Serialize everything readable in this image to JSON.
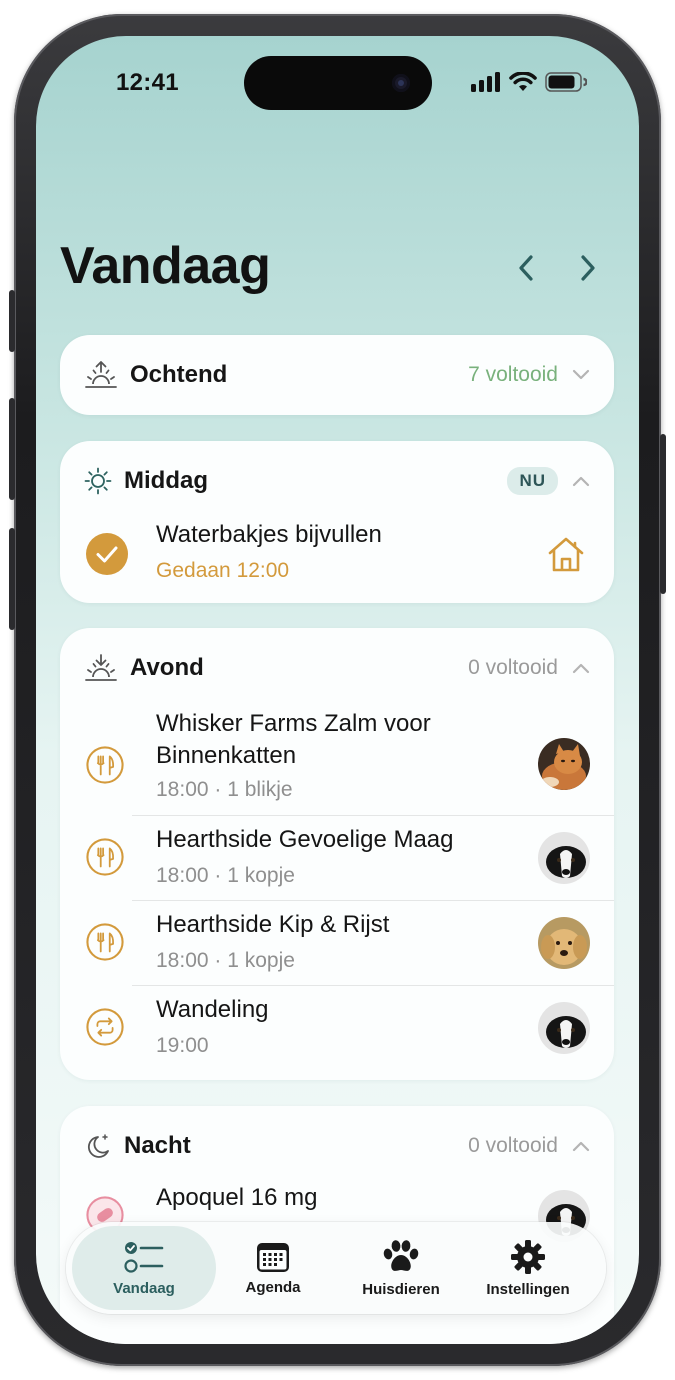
{
  "status_bar": {
    "time": "12:41"
  },
  "header": {
    "title": "Vandaag"
  },
  "sections": [
    {
      "title": "Ochtend",
      "summary": "7 voltooid",
      "icon": "sunrise-icon",
      "expanded": false
    },
    {
      "title": "Middag",
      "badge": "NU",
      "icon": "sun-icon",
      "expanded": true,
      "tasks": [
        {
          "title": "Waterbakjes bijvullen",
          "subtitle": "Gedaan 12:00",
          "status": "done",
          "trailing_icon": "house-icon"
        }
      ]
    },
    {
      "title": "Avond",
      "summary": "0 voltooid",
      "icon": "sunset-icon",
      "expanded": true,
      "tasks": [
        {
          "title": "Whisker Farms Zalm voor Binnenkatten",
          "subtitle": "18:00 · 1 blikje",
          "icon": "food-icon",
          "pet": "orange-cat"
        },
        {
          "title": "Hearthside Gevoelige Maag",
          "subtitle": "18:00 · 1 kopje",
          "icon": "food-icon",
          "pet": "border-collie"
        },
        {
          "title": "Hearthside Kip & Rijst",
          "subtitle": "18:00 · 1 kopje",
          "icon": "food-icon",
          "pet": "golden-retriever"
        },
        {
          "title": "Wandeling",
          "subtitle": "19:00",
          "icon": "walk-repeat-icon",
          "pet": "border-collie"
        }
      ]
    },
    {
      "title": "Nacht",
      "summary": "0 voltooid",
      "icon": "moon-icon",
      "expanded": true,
      "tasks": [
        {
          "title": "Apoquel 16 mg",
          "icon": "pill-icon",
          "pet": "border-collie"
        }
      ]
    }
  ],
  "tabbar": {
    "tabs": [
      {
        "label": "Vandaag",
        "icon": "checklist-icon",
        "active": true
      },
      {
        "label": "Agenda",
        "icon": "calendar-icon",
        "active": false
      },
      {
        "label": "Huisdieren",
        "icon": "paw-icon",
        "active": false
      },
      {
        "label": "Instellingen",
        "icon": "gear-icon",
        "active": false
      }
    ]
  },
  "colors": {
    "accent_orange": "#d39a3c",
    "done_green": "#79b17c",
    "teal": "#2c5f5f",
    "pill_pink": "#e88ea0"
  }
}
